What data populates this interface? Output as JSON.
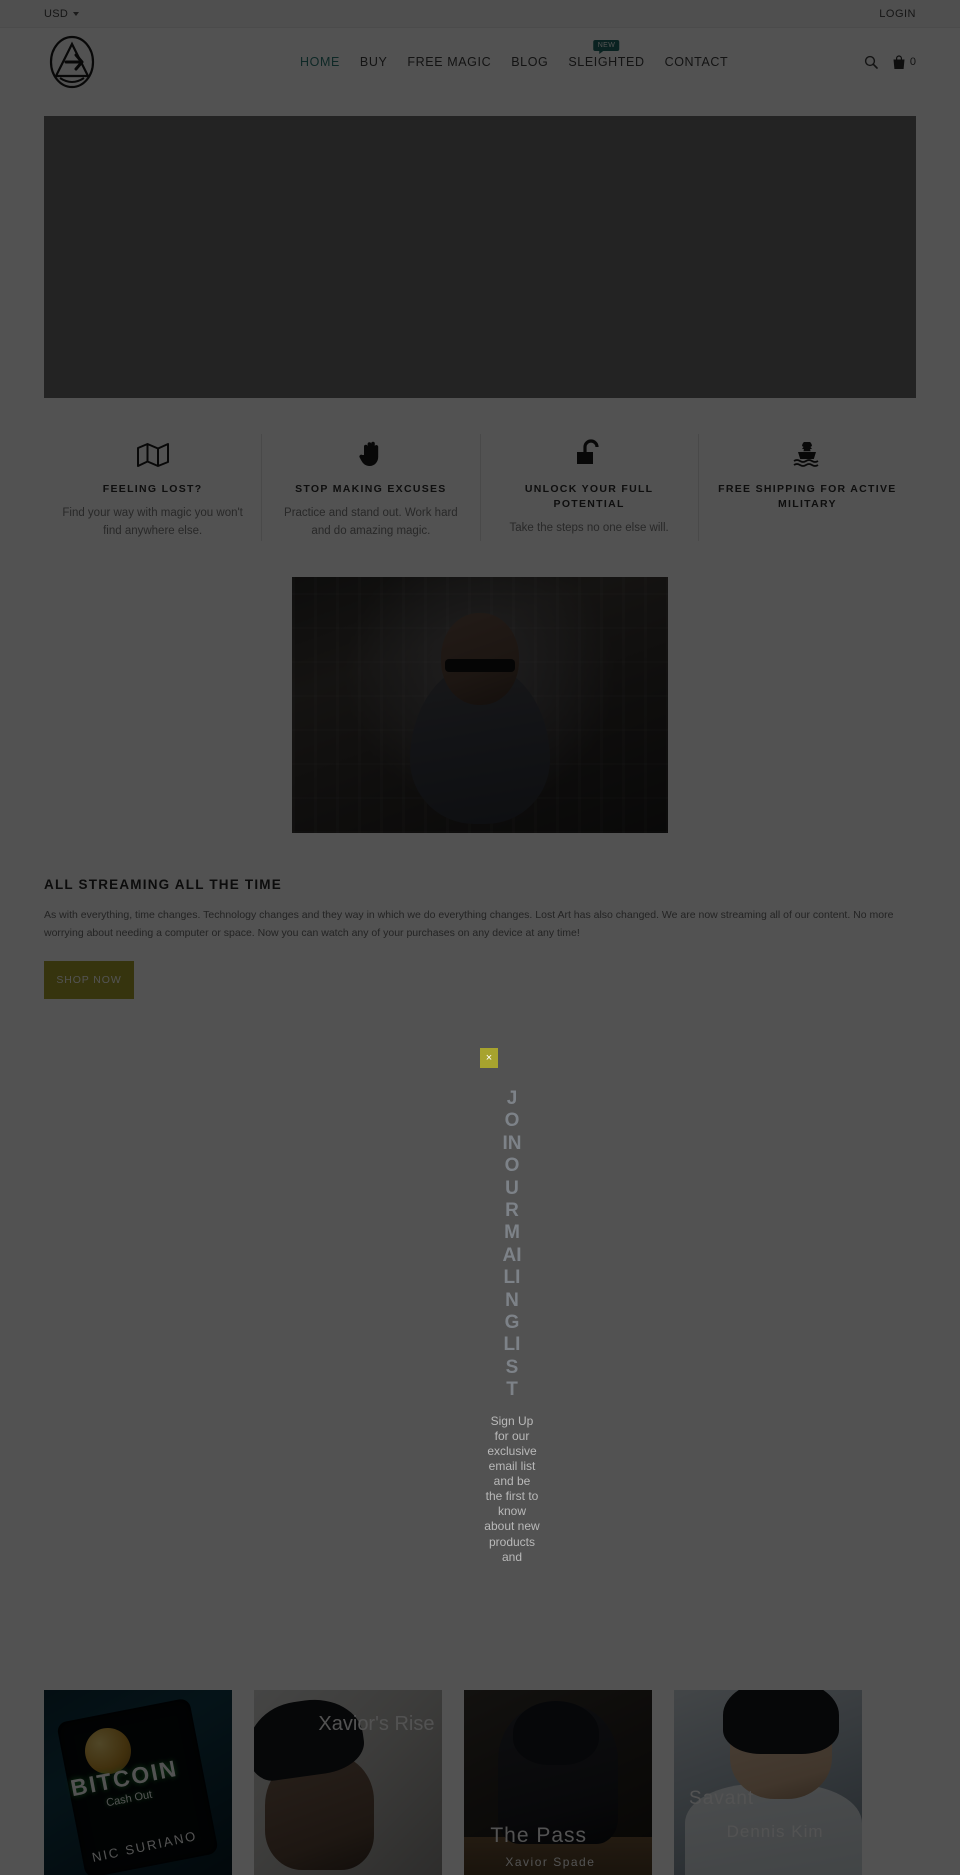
{
  "topbar": {
    "currency": "USD",
    "login": "LOGIN"
  },
  "header": {
    "logo_alt": "lost-art-logo",
    "nav": [
      {
        "label": "HOME",
        "active": true,
        "badge": ""
      },
      {
        "label": "BUY",
        "active": false,
        "badge": ""
      },
      {
        "label": "FREE MAGIC",
        "active": false,
        "badge": ""
      },
      {
        "label": "BLOG",
        "active": false,
        "badge": ""
      },
      {
        "label": "SLEIGHTED",
        "active": false,
        "badge": "NEW"
      },
      {
        "label": "CONTACT",
        "active": false,
        "badge": ""
      }
    ],
    "cart_count": "0",
    "accent_color": "#2e7d78",
    "badge_color": "#1f6b66"
  },
  "features": [
    {
      "icon": "map-icon",
      "title": "FEELING LOST?",
      "text": "Find your way with magic you won't find anywhere else."
    },
    {
      "icon": "hand-icon",
      "title": "STOP MAKING EXCUSES",
      "text": "Practice and stand out. Work hard and do amazing magic."
    },
    {
      "icon": "unlock-icon",
      "title": "UNLOCK YOUR FULL POTENTIAL",
      "text": "Take the steps no one else will."
    },
    {
      "icon": "ship-icon",
      "title": "FREE SHIPPING FOR ACTIVE MILITARY",
      "text": ""
    }
  ],
  "streaming": {
    "title": "ALL STREAMING ALL THE TIME",
    "body": "As with everything, time changes. Technology changes and they way in which we do everything changes. Lost Art has also changed. We are now streaming all of our content. No more worrying about needing a computer or space. Now you can watch any of your purchases on any device at any time!",
    "button": "SHOP NOW",
    "button_color": "#a7a32e"
  },
  "popup": {
    "close_label": "×",
    "heading": "JOIN OUR MAILING LIST",
    "body": "Sign Up for our exclusive email list and be the first to know about new products and"
  },
  "products": [
    {
      "title": "BITCOIN",
      "subtitle": "Cash Out",
      "author": "NIC SURIANO"
    },
    {
      "title": "Xavior's Rise",
      "subtitle": "",
      "author": ""
    },
    {
      "title": "The Pass",
      "subtitle": "",
      "author": "Xavior Spade"
    },
    {
      "title": "Savant",
      "subtitle": "",
      "author": "Dennis Kim"
    }
  ]
}
